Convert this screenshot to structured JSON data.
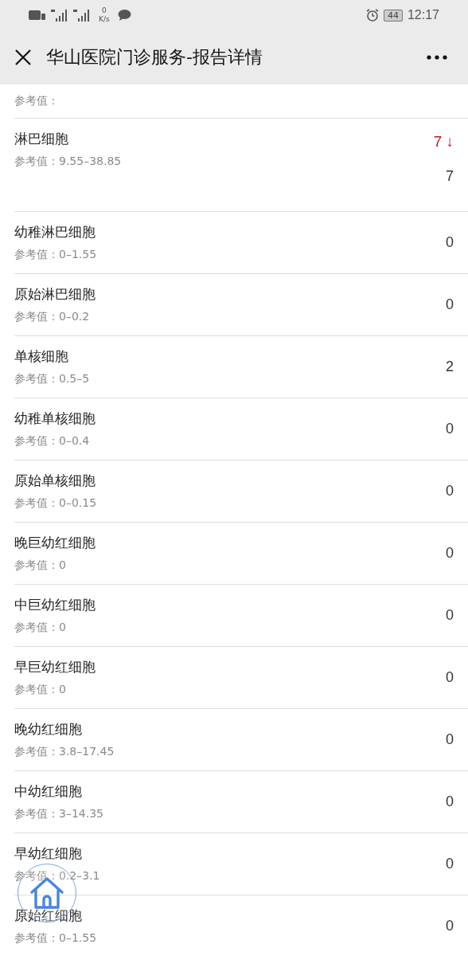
{
  "status_bar": {
    "speed_value": "0",
    "speed_unit": "K/s",
    "battery": "44",
    "time": "12:17"
  },
  "header": {
    "title": "华山医院门诊服务-报告详情"
  },
  "partial_row": {
    "reference": "参考值："
  },
  "results": [
    {
      "name": "淋巴细胞",
      "reference": "参考值：9.55–38.85",
      "flag": "7 ↓",
      "value": "7"
    },
    {
      "name": "幼稚淋巴细胞",
      "reference": "参考值：0–1.55",
      "value": "0"
    },
    {
      "name": "原始淋巴细胞",
      "reference": "参考值：0–0.2",
      "value": "0"
    },
    {
      "name": "单核细胞",
      "reference": "参考值：0.5–5",
      "value": "2"
    },
    {
      "name": "幼稚单核细胞",
      "reference": "参考值：0–0.4",
      "value": "0"
    },
    {
      "name": "原始单核细胞",
      "reference": "参考值：0–0.15",
      "value": "0"
    },
    {
      "name": "晚巨幼红细胞",
      "reference": "参考值：0",
      "value": "0"
    },
    {
      "name": "中巨幼红细胞",
      "reference": "参考值：0",
      "value": "0"
    },
    {
      "name": "早巨幼红细胞",
      "reference": "参考值：0",
      "value": "0"
    },
    {
      "name": "晚幼红细胞",
      "reference": "参考值：3.8–17.45",
      "value": "0"
    },
    {
      "name": "中幼红细胞",
      "reference": "参考值：3–14.35",
      "value": "0"
    },
    {
      "name": "早幼红细胞",
      "reference": "参考值：0.2–3.1",
      "value": "0"
    },
    {
      "name": "原始红细胞",
      "reference": "参考值：0–1.55",
      "value": "0"
    }
  ]
}
